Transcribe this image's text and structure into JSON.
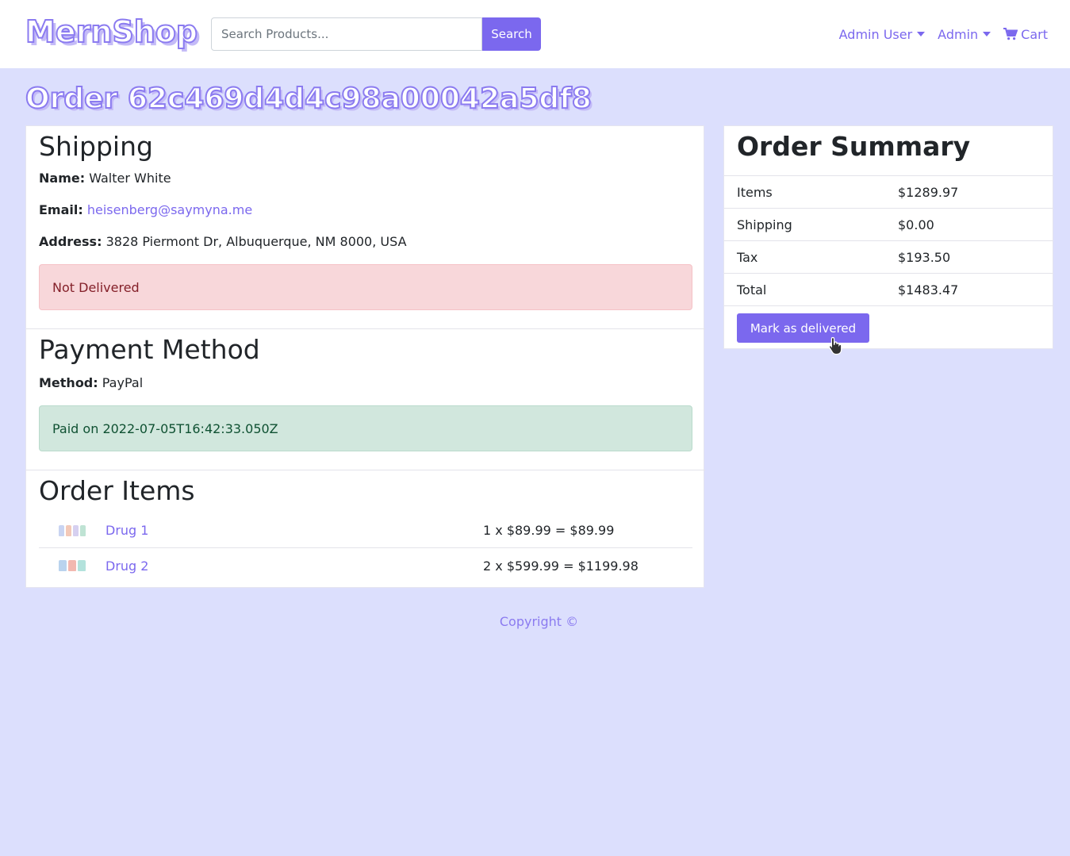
{
  "brand": "MernShop",
  "search": {
    "placeholder": "Search Products...",
    "button_label": "Search"
  },
  "nav": {
    "user_label": "Admin User",
    "admin_label": "Admin",
    "cart_label": "Cart"
  },
  "order": {
    "title": "Order 62c469d4d4c98a00042a5df8"
  },
  "shipping": {
    "heading": "Shipping",
    "name_label": "Name:",
    "name": "Walter White",
    "email_label": "Email:",
    "email": "heisenberg@saymyna.me",
    "address_label": "Address:",
    "address": "3828 Piermont Dr, Albuquerque, NM 8000, USA",
    "status": "Not Delivered"
  },
  "payment": {
    "heading": "Payment Method",
    "method_label": "Method:",
    "method": "PayPal",
    "status": "Paid on 2022-07-05T16:42:33.050Z"
  },
  "items": {
    "heading": "Order Items",
    "rows": [
      {
        "name": "Drug 1",
        "price_line": "1 x $89.99 = $89.99"
      },
      {
        "name": "Drug 2",
        "price_line": "2 x $599.99 = $1199.98"
      }
    ]
  },
  "summary": {
    "heading": "Order Summary",
    "rows": [
      {
        "label": "Items",
        "value": "$1289.97"
      },
      {
        "label": "Shipping",
        "value": "$0.00"
      },
      {
        "label": "Tax",
        "value": "$193.50"
      },
      {
        "label": "Total",
        "value": "$1483.47"
      }
    ],
    "button_label": "Mark as delivered"
  },
  "footer": {
    "text": "Copyright ©"
  },
  "colors": {
    "accent": "#7b68ee",
    "background": "#dcdffd",
    "danger_bg": "#f8d7da",
    "success_bg": "#d1e7dd"
  }
}
